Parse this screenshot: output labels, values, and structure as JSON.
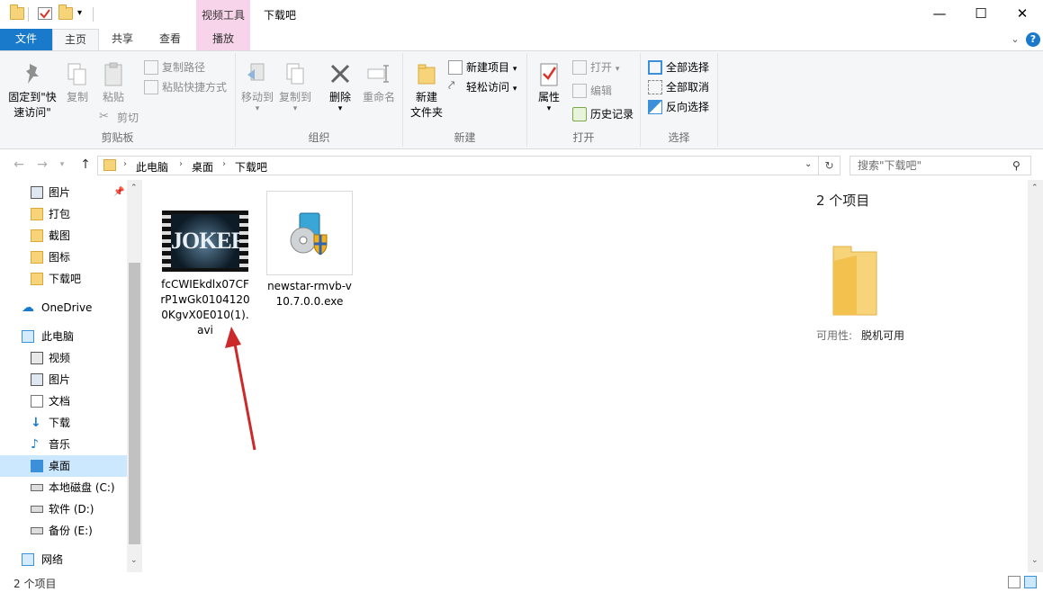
{
  "window": {
    "title": "下载吧",
    "contextual_tab_group": "视频工具",
    "minimize": "—",
    "maximize": "☐",
    "close": "✕"
  },
  "ribbon_tabs": {
    "file": "文件",
    "home": "主页",
    "share": "共享",
    "view": "查看",
    "play": "播放"
  },
  "ribbon": {
    "clipboard": {
      "title": "剪贴板",
      "pin_line1": "固定到\"快",
      "pin_line2": "速访问\"",
      "copy": "复制",
      "paste": "粘贴",
      "copy_path": "复制路径",
      "paste_shortcut": "粘贴快捷方式",
      "cut": "剪切"
    },
    "organize": {
      "title": "组织",
      "move_to": "移动到",
      "copy_to": "复制到",
      "delete": "删除",
      "rename": "重命名"
    },
    "new": {
      "title": "新建",
      "new_folder_line1": "新建",
      "new_folder_line2": "文件夹",
      "new_item": "新建项目",
      "easy_access": "轻松访问"
    },
    "open": {
      "title": "打开",
      "properties": "属性",
      "open": "打开",
      "edit": "编辑",
      "history": "历史记录"
    },
    "select": {
      "title": "选择",
      "select_all": "全部选择",
      "select_none": "全部取消",
      "invert": "反向选择"
    }
  },
  "address": {
    "crumbs": [
      "此电脑",
      "桌面",
      "下载吧"
    ],
    "search_placeholder": "搜索\"下载吧\""
  },
  "nav_pane": {
    "quick_access": [
      {
        "label": "图片"
      },
      {
        "label": "打包"
      },
      {
        "label": "截图"
      },
      {
        "label": "图标"
      },
      {
        "label": "下载吧"
      }
    ],
    "onedrive": "OneDrive",
    "this_pc": "此电脑",
    "pc_items": [
      {
        "label": "视频"
      },
      {
        "label": "图片"
      },
      {
        "label": "文档"
      },
      {
        "label": "下载"
      },
      {
        "label": "音乐"
      },
      {
        "label": "桌面"
      },
      {
        "label": "本地磁盘 (C:)"
      },
      {
        "label": "软件 (D:)"
      },
      {
        "label": "备份 (E:)"
      }
    ],
    "network": "网络"
  },
  "files": [
    {
      "name": "fcCWIEkdlx07CFrP1wGk01041200KgvX0E010(1).avi",
      "name_lines": [
        "fcCWIEkdlx07CF",
        "rP1wGk0104120",
        "0KgvX0E010(1).",
        "avi"
      ],
      "thumb_text": "JOKER"
    },
    {
      "name": "newstar-rmvb-v10.7.0.0.exe",
      "name_lines": [
        "newstar-rmvb-v",
        "10.7.0.0.exe"
      ]
    }
  ],
  "details": {
    "item_count": "2 个项目",
    "availability_label": "可用性:",
    "availability_value": "脱机可用"
  },
  "status": {
    "item_count": "2 个项目"
  }
}
